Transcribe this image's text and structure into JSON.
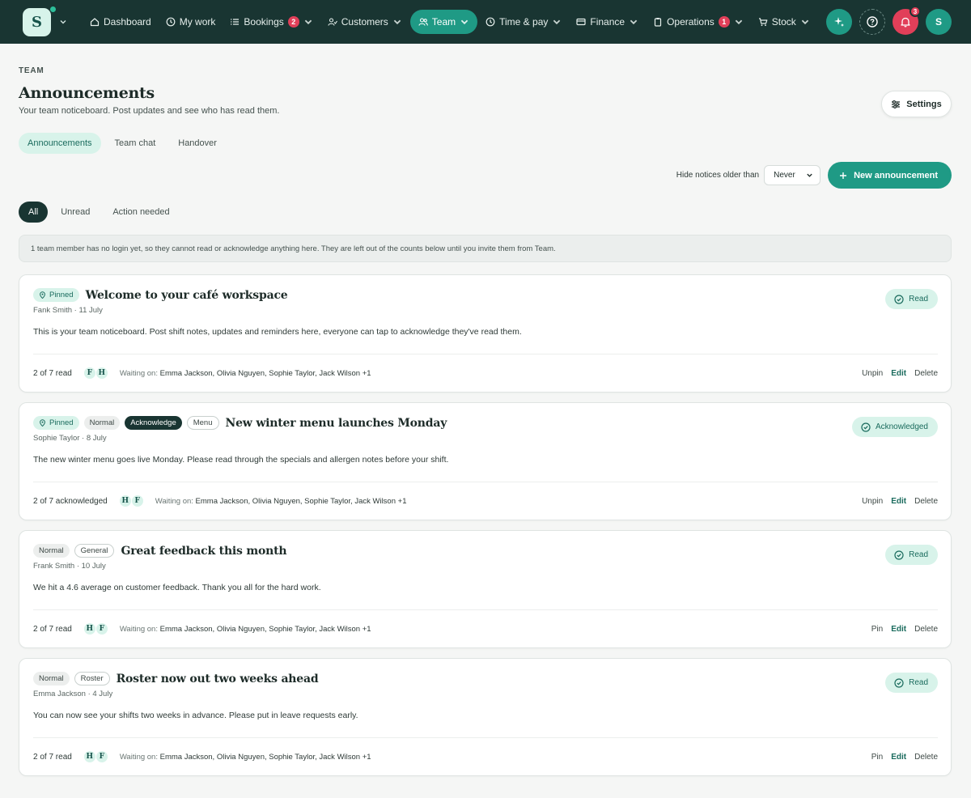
{
  "brand": {
    "logo_letter": "S"
  },
  "nav": [
    {
      "label": "Dashboard",
      "icon": "home-icon",
      "active": false,
      "badge": null,
      "dropdown": false
    },
    {
      "label": "My work",
      "icon": "clock-icon",
      "active": false,
      "badge": null,
      "dropdown": false
    },
    {
      "label": "Bookings",
      "icon": "list-icon",
      "active": false,
      "badge": "2",
      "dropdown": true
    },
    {
      "label": "Customers",
      "icon": "users-icon",
      "active": false,
      "badge": null,
      "dropdown": true
    },
    {
      "label": "Team",
      "icon": "team-icon",
      "active": true,
      "badge": null,
      "dropdown": true
    },
    {
      "label": "Time & pay",
      "icon": "clock-icon",
      "active": false,
      "badge": null,
      "dropdown": true
    },
    {
      "label": "Finance",
      "icon": "card-icon",
      "active": false,
      "badge": null,
      "dropdown": true
    },
    {
      "label": "Operations",
      "icon": "clipboard-icon",
      "active": false,
      "badge": "1",
      "dropdown": true
    },
    {
      "label": "Stock",
      "icon": "cart-icon",
      "active": false,
      "badge": null,
      "dropdown": true
    }
  ],
  "topright": {
    "notifications": "3",
    "avatar": "S"
  },
  "page": {
    "eyebrow": "TEAM",
    "title": "Announcements",
    "subtitle": "Your team noticeboard. Post updates and see who has read them.",
    "settings_label": "Settings"
  },
  "tabs": [
    "Announcements",
    "Team chat",
    "Handover"
  ],
  "toolbar": {
    "hide_label": "Hide notices older than",
    "hide_value": "Never",
    "new_label": "New announcement"
  },
  "filters": [
    "All",
    "Unread",
    "Action needed"
  ],
  "notice": "1 team member has no login yet, so they cannot read or acknowledge anything here. They are left out of the counts below until you invite them from Team.",
  "waiting_label": "Waiting on:",
  "cards": [
    {
      "tags": [
        {
          "type": "pinned",
          "text": "Pinned"
        }
      ],
      "title": "Welcome to your café workspace",
      "meta": "Fank Smith · 11 July",
      "body": "This is your team noticeboard. Post shift notes, updates and reminders here, everyone can tap to acknowledge they've read them.",
      "status": "Read",
      "count": "2 of 7 read",
      "avatars": [
        "F",
        "H"
      ],
      "waiting": "Emma Jackson, Olivia Nguyen, Sophie Taylor, Jack Wilson +1",
      "actions": [
        "Unpin",
        "Edit",
        "Delete"
      ]
    },
    {
      "tags": [
        {
          "type": "pinned",
          "text": "Pinned"
        },
        {
          "type": "normal",
          "text": "Normal"
        },
        {
          "type": "ack",
          "text": "Acknowledge"
        },
        {
          "type": "outline",
          "text": "Menu"
        }
      ],
      "title": "New winter menu launches Monday",
      "meta": "Sophie Taylor · 8 July",
      "body": "The new winter menu goes live Monday. Please read through the specials and allergen notes before your shift.",
      "status": "Acknowledged",
      "count": "2 of 7 acknowledged",
      "avatars": [
        "H",
        "F"
      ],
      "waiting": "Emma Jackson, Olivia Nguyen, Sophie Taylor, Jack Wilson +1",
      "actions": [
        "Unpin",
        "Edit",
        "Delete"
      ]
    },
    {
      "tags": [
        {
          "type": "normal",
          "text": "Normal"
        },
        {
          "type": "outline",
          "text": "General"
        }
      ],
      "title": "Great feedback this month",
      "meta": "Frank Smith · 10 July",
      "body": "We hit a 4.6 average on customer feedback. Thank you all for the hard work.",
      "status": "Read",
      "count": "2 of 7 read",
      "avatars": [
        "H",
        "F"
      ],
      "waiting": "Emma Jackson, Olivia Nguyen, Sophie Taylor, Jack Wilson +1",
      "actions": [
        "Pin",
        "Edit",
        "Delete"
      ]
    },
    {
      "tags": [
        {
          "type": "normal",
          "text": "Normal"
        },
        {
          "type": "outline",
          "text": "Roster"
        }
      ],
      "title": "Roster now out two weeks ahead",
      "meta": "Emma Jackson · 4 July",
      "body": "You can now see your shifts two weeks in advance. Please put in leave requests early.",
      "status": "Read",
      "count": "2 of 7 read",
      "avatars": [
        "H",
        "F"
      ],
      "waiting": "Emma Jackson, Olivia Nguyen, Sophie Taylor, Jack Wilson +1",
      "actions": [
        "Pin",
        "Edit",
        "Delete"
      ]
    }
  ],
  "colors": {
    "nav_bg": "#193532",
    "accent": "#1f9a85",
    "badge": "#e13f59",
    "pill_bg": "#d8f3ea"
  }
}
